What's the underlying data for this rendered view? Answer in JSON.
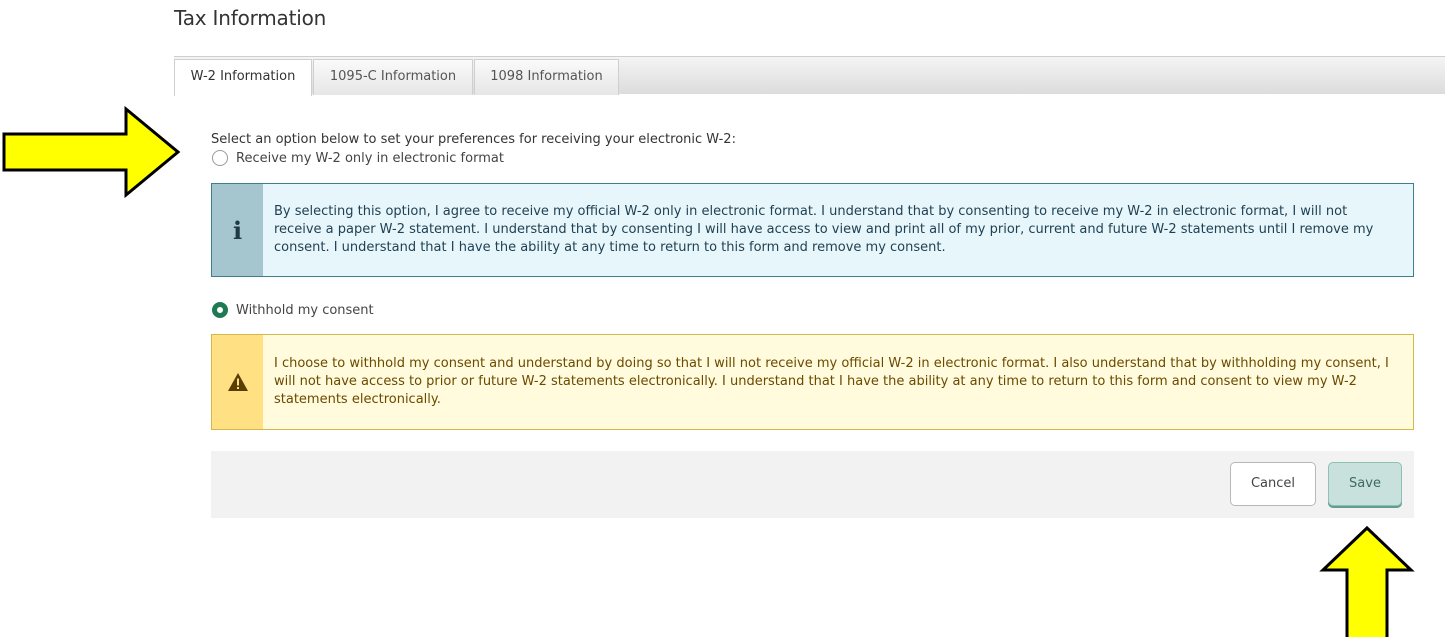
{
  "page": {
    "title": "Tax Information"
  },
  "tabs": [
    {
      "label": "W-2 Information",
      "active": true
    },
    {
      "label": "1095-C Information",
      "active": false
    },
    {
      "label": "1098 Information",
      "active": false
    }
  ],
  "form": {
    "prompt": "Select an option below to set your preferences for receiving your electronic W-2:",
    "options": [
      {
        "label": "Receive my W-2 only in electronic format",
        "selected": false,
        "notice": "By selecting this option, I agree to receive my official W-2 only in electronic format. I understand that by consenting to receive my W-2 in electronic format, I will not receive a paper W-2 statement. I understand that by consenting I will have access to view and print all of my prior, current and future W-2 statements until I remove my consent. I understand that I have the ability at any time to return to this form and remove my consent.",
        "notice_icon": "info-icon",
        "notice_icon_glyph": "i"
      },
      {
        "label": "Withhold my consent",
        "selected": true,
        "notice": "I choose to withhold my consent and understand by doing so that I will not receive my official W-2 in electronic format. I also understand that by withholding my consent, I will not have access to prior or future W-2 statements electronically. I understand that I have the ability at any time to return to this form and consent to view my W-2 statements electronically.",
        "notice_icon": "warning-icon"
      }
    ]
  },
  "actions": {
    "cancel_label": "Cancel",
    "save_label": "Save"
  },
  "colors": {
    "selected_radio": "#1f7a54",
    "info_border": "#3d7f8a",
    "info_background": "#e6f6fa",
    "warning_border": "#d5b84a",
    "warning_background": "#fffbdc",
    "annotation_arrow": "#ffff00"
  },
  "annotations": [
    {
      "type": "arrow",
      "direction": "right",
      "icon": "arrow-right-icon"
    },
    {
      "type": "arrow",
      "direction": "up",
      "icon": "arrow-up-icon"
    }
  ]
}
